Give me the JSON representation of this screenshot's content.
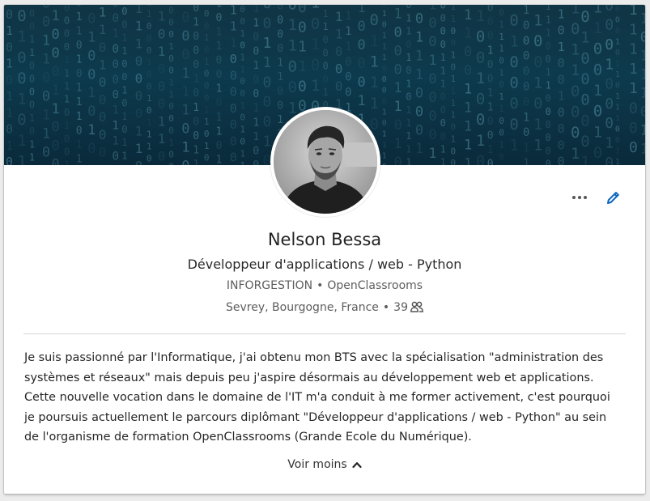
{
  "profile": {
    "name": "Nelson Bessa",
    "headline": "Développeur d'applications / web - Python",
    "organizations": [
      "INFORGESTION",
      "OpenClassrooms"
    ],
    "location": "Sevrey, Bourgogne, France",
    "connections": "39",
    "summary": "Je suis passionné par l'Informatique, j'ai obtenu mon BTS avec la spécialisation \"administration des systèmes et réseaux\" mais depuis peu j'aspire désormais au développement web et applications. Cette nouvelle vocation dans le domaine de l'IT m'a conduit à me former activement, c'est pourquoi je poursuis actuellement le parcours diplômant \"Développeur d'applications / web - Python\" au sein de l'organisme de formation OpenClassrooms (Grande Ecole du Numérique)."
  },
  "actions": {
    "show_less_label": "Voir moins"
  },
  "icons": {
    "more": "more-horizontal-icon",
    "edit": "pencil-icon",
    "connections": "people-icon",
    "show_less": "chevron-up-icon"
  },
  "colors": {
    "accent": "#0a66c2",
    "banner": "#0d3a4d"
  }
}
